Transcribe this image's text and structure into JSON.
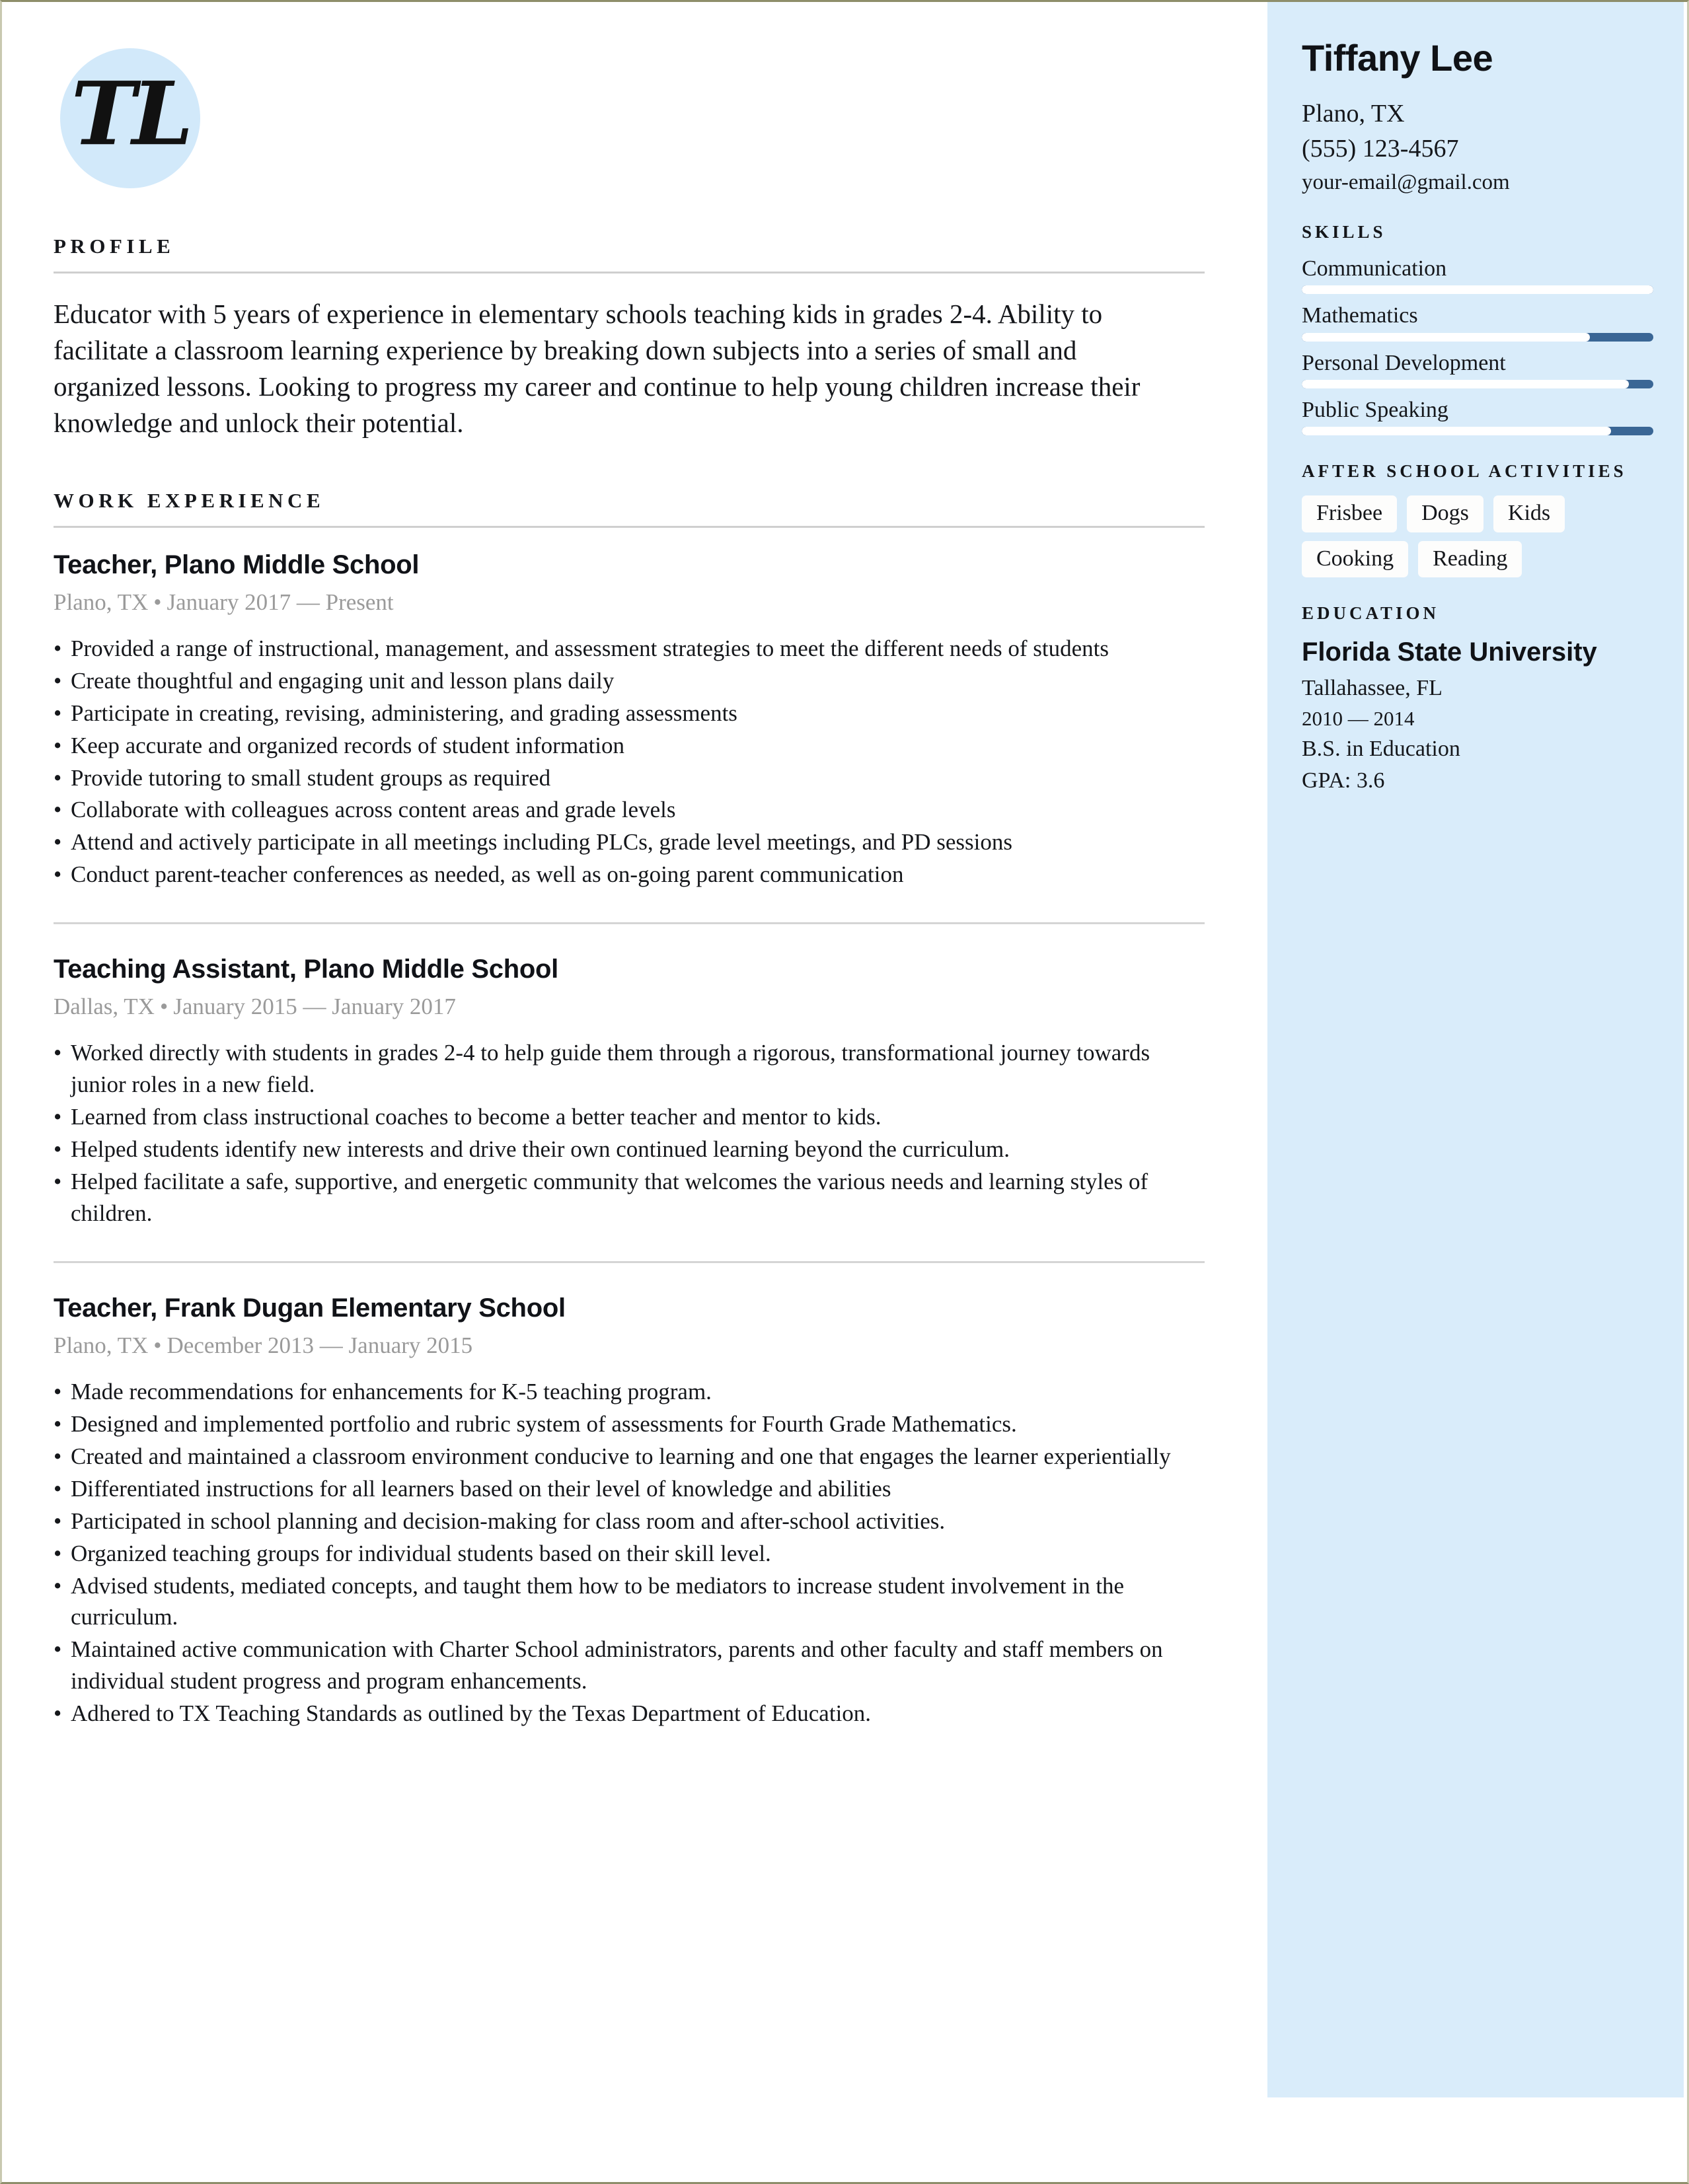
{
  "monogram": {
    "initials": "TL"
  },
  "sidebar": {
    "name": "Tiffany Lee",
    "location": "Plano, TX",
    "phone": "(555) 123-4567",
    "email": "your-email@gmail.com",
    "skills_heading": "SKILLS",
    "skills": [
      {
        "label": "Communication",
        "fill_percent": 100
      },
      {
        "label": "Mathematics",
        "fill_percent": 82
      },
      {
        "label": "Personal Development",
        "fill_percent": 93
      },
      {
        "label": "Public Speaking",
        "fill_percent": 88
      }
    ],
    "activities_heading": "AFTER SCHOOL ACTIVITIES",
    "activities": [
      "Frisbee",
      "Dogs",
      "Kids",
      "Cooking",
      "Reading"
    ],
    "education_heading": "EDUCATION",
    "education": {
      "school": "Florida State University",
      "location": "Tallahassee, FL",
      "dates": "2010 — 2014",
      "degree": "B.S. in Education",
      "gpa": "GPA: 3.6"
    }
  },
  "main": {
    "profile_heading": "PROFILE",
    "profile_text": "Educator with 5 years of experience in elementary schools teaching kids in grades 2-4. Ability to facilitate a classroom learning experience by breaking down subjects into a series of small and organized lessons. Looking to progress my career and continue to help young children increase their knowledge and unlock their potential.",
    "work_heading": "WORK EXPERIENCE",
    "jobs": [
      {
        "title": "Teacher, Plano Middle School",
        "location": "Plano, TX",
        "dates": "January 2017 — Present",
        "bullets": [
          "Provided a range of instructional, management, and assessment strategies to meet the different needs of students",
          "Create thoughtful and engaging unit and lesson plans daily",
          "Participate in creating, revising, administering, and grading assessments",
          "Keep accurate and organized records of student information",
          "Provide tutoring to small student groups as required",
          "Collaborate with colleagues across content areas and grade levels",
          "Attend and actively participate in all meetings including PLCs, grade level meetings, and PD sessions",
          "Conduct parent-teacher conferences as needed, as well as on-going parent communication"
        ]
      },
      {
        "title": "Teaching Assistant, Plano Middle School",
        "location": "Dallas, TX",
        "dates": "January 2015 — January 2017",
        "bullets": [
          "Worked directly with students in grades 2-4 to help guide them through a rigorous, transformational journey towards junior roles in a new field.",
          "Learned from class instructional coaches to become a better teacher and mentor to kids.",
          "Helped students identify new interests and drive their own continued learning beyond the curriculum.",
          "Helped facilitate a safe, supportive, and energetic community that welcomes the various needs and learning styles of children."
        ]
      },
      {
        "title": "Teacher, Frank Dugan Elementary School",
        "location": "Plano, TX",
        "dates": "December 2013 — January 2015",
        "bullets": [
          "Made recommendations for enhancements for K-5 teaching program.",
          "Designed and implemented portfolio and rubric system of assessments for Fourth Grade Mathematics.",
          "Created and maintained a classroom environment conducive to learning and one that engages the learner experientially",
          "Differentiated instructions for all learners based on their level of knowledge and abilities",
          "Participated in school planning and decision-making for class room and after-school activities.",
          "Organized teaching groups for individual students based on their skill level.",
          "Advised students, mediated concepts, and taught them how to be mediators to increase student involvement in the curriculum.",
          "Maintained active communication with Charter School administrators, parents and other faculty and staff members on individual student progress and program enhancements.",
          "Adhered to TX Teaching Standards as outlined by the Texas Department of Education."
        ]
      }
    ]
  },
  "colors": {
    "sidebar_bg": "#d9ecfa",
    "monogram_bg": "#d2e9fa",
    "skill_bar_accent": "#3a6695",
    "skill_bar_fill": "#ffffff",
    "rule": "#cfcfcf",
    "meta_text": "#9a9a9a"
  },
  "separator": {
    "bullet": "•"
  }
}
